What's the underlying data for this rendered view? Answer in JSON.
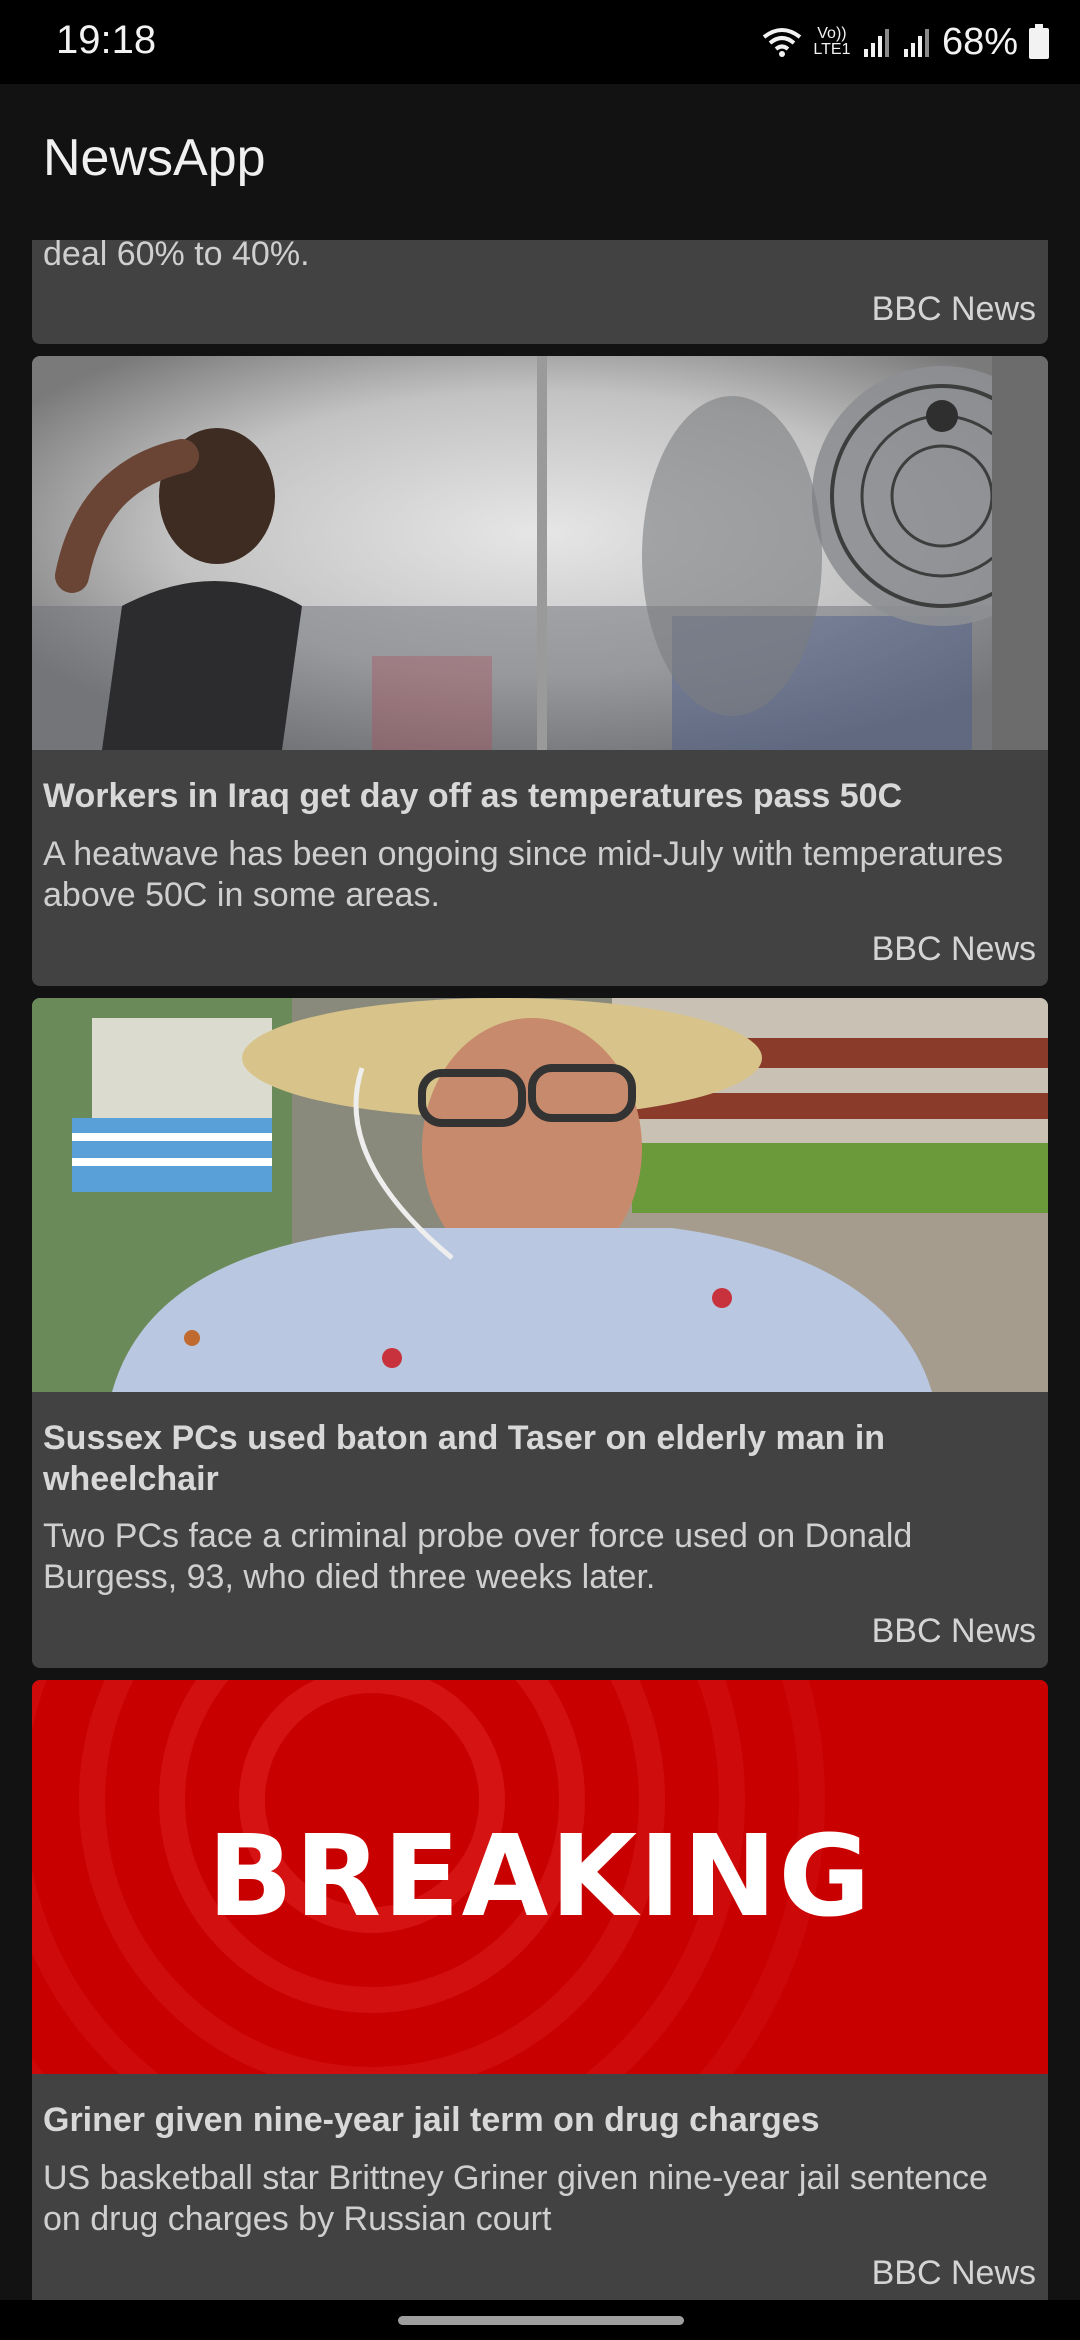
{
  "status_bar": {
    "time": "19:18",
    "network_label": "Vo)) LTE1",
    "battery_percent": "68%",
    "icons": [
      "wifi-icon",
      "volte-icon",
      "signal-icon",
      "signal-icon",
      "battery-icon"
    ]
  },
  "app_bar": {
    "title": "NewsApp"
  },
  "articles": [
    {
      "headline": "",
      "description": "deal 60% to 40%.",
      "source": "BBC News"
    },
    {
      "headline": "Workers in Iraq get day off as temperatures pass 50C",
      "description": "A heatwave has been ongoing since mid-July with temperatures above 50C in some areas.",
      "source": "BBC News",
      "image": "man-by-mist-fan-photo"
    },
    {
      "headline": "Sussex PCs used baton and Taser on elderly man in wheelchair",
      "description": "Two PCs face a criminal probe over force used on Donald Burgess, 93, who died three weeks later.",
      "source": "BBC News",
      "image": "elderly-man-portrait-photo"
    },
    {
      "headline": "Griner given nine-year jail term on drug charges",
      "description": "US basketball star Brittney Griner given nine-year jail sentence on drug charges by Russian court",
      "source": "BBC News",
      "image": "breaking-news-banner",
      "image_text": "BREAKING"
    }
  ],
  "colors": {
    "background": "#121212",
    "card": "#424242",
    "breaking_red": "#c80000"
  }
}
